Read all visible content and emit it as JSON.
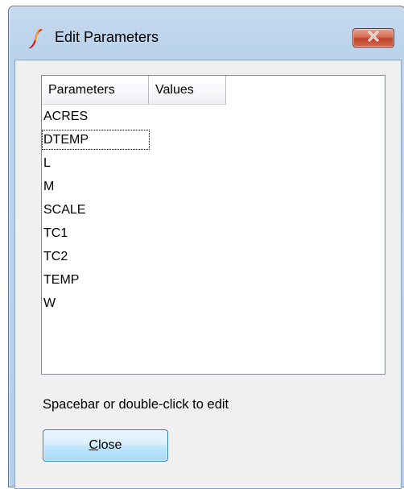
{
  "window": {
    "title": "Edit Parameters",
    "app_icon": "lt-spice-icon",
    "close_icon": "close-icon"
  },
  "listview": {
    "columns": [
      "Parameters",
      "Values"
    ],
    "rows": [
      {
        "name": "ACRES",
        "value": ""
      },
      {
        "name": "DTEMP",
        "value": "",
        "focused": true
      },
      {
        "name": "L",
        "value": ""
      },
      {
        "name": "M",
        "value": ""
      },
      {
        "name": "SCALE",
        "value": ""
      },
      {
        "name": "TC1",
        "value": ""
      },
      {
        "name": "TC2",
        "value": ""
      },
      {
        "name": "TEMP",
        "value": ""
      },
      {
        "name": "W",
        "value": ""
      }
    ]
  },
  "hint": "Spacebar or double-click to edit",
  "buttons": {
    "close_label": "Close"
  },
  "colors": {
    "title_bar": "#bcd3ec",
    "close_button": "#c0432a",
    "client_bg": "#f0f0f0"
  }
}
